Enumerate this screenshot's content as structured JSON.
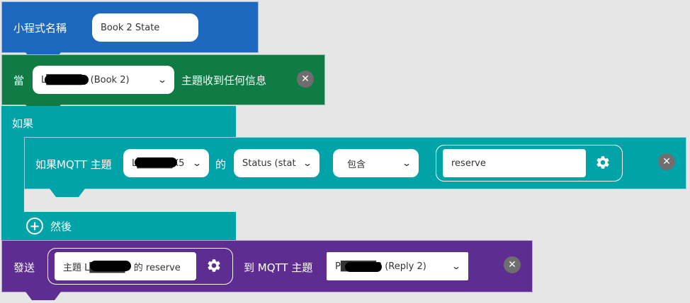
{
  "program": {
    "title_label": "小程式名稱",
    "name_value": "Book 2 State",
    "color": "#1e69c0"
  },
  "trigger": {
    "when_label": "當",
    "device_select": "L█████5 (Book 2)",
    "suffix_label": "主題收到任何信息",
    "close_icon": "close-icon",
    "color": "#107b44"
  },
  "if_block": {
    "label": "如果",
    "then_label": "然後",
    "plus_icon": "plus-icon",
    "color": "#00a3a8"
  },
  "condition": {
    "prefix_label": "如果MQTT 主題",
    "topic_select": "L█████X5",
    "of_label": "的",
    "field_select": "Status (stat",
    "operator_select": "包含",
    "value_input": "reserve",
    "gear_icon": "gear-icon",
    "close_icon": "close-icon"
  },
  "send": {
    "label": "發送",
    "message_text": "主題 L█████5 的 reserve",
    "to_label": "到 MQTT 主題",
    "target_select": "P█████8 (Reply 2)",
    "gear_icon": "gear-icon",
    "close_icon": "close-icon",
    "color": "#5d2d91"
  }
}
